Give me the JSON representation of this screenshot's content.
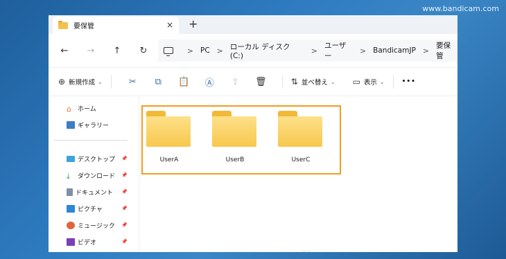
{
  "watermark": "www.bandicam.com",
  "tab": {
    "title": "要保管",
    "close": "×",
    "new": "+"
  },
  "nav": {
    "back": "←",
    "forward": "→",
    "up": "↑",
    "refresh": "↻"
  },
  "breadcrumb": [
    "PC",
    "ローカル ディスク (C:)",
    "ユーザー",
    "BandicamJP",
    "要保管"
  ],
  "breadcrumb_sep": ">",
  "toolbar": {
    "new_label": "新規作成",
    "sort_label": "並べ替え",
    "view_label": "表示",
    "more": "•••"
  },
  "sidebar": {
    "top": [
      {
        "label": "ホーム",
        "icon": "home-icon"
      },
      {
        "label": "ギャラリー",
        "icon": "gallery-icon"
      }
    ],
    "pinned": [
      {
        "label": "デスクトップ",
        "icon": "desktop-icon"
      },
      {
        "label": "ダウンロード",
        "icon": "download-icon"
      },
      {
        "label": "ドキュメント",
        "icon": "document-icon"
      },
      {
        "label": "ピクチャ",
        "icon": "picture-icon"
      },
      {
        "label": "ミュージック",
        "icon": "music-icon"
      },
      {
        "label": "ビデオ",
        "icon": "video-icon"
      }
    ]
  },
  "folders": [
    {
      "name": "UserA"
    },
    {
      "name": "UserB"
    },
    {
      "name": "UserC"
    }
  ],
  "colors": {
    "highlight": "#f39c1f",
    "folder": "#f7c84c",
    "background": "#2f7cc2"
  }
}
